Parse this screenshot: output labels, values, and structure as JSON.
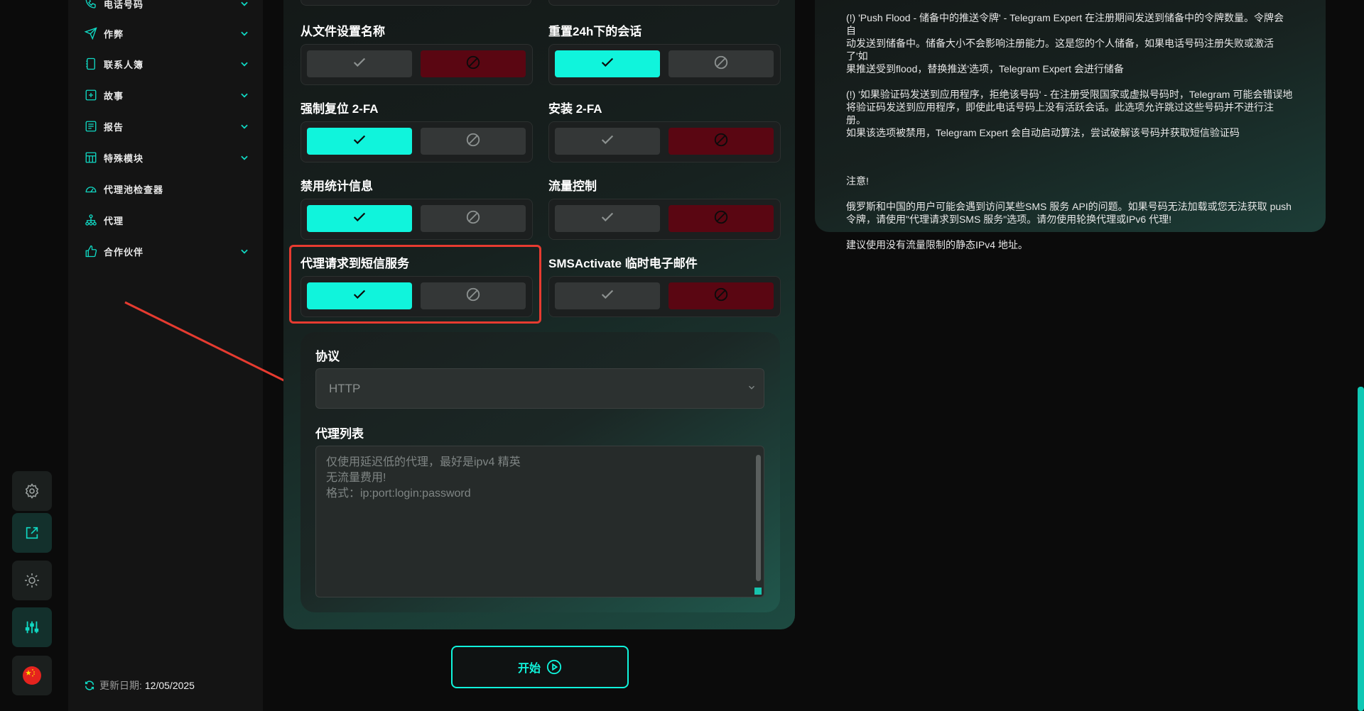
{
  "sidebar": {
    "items": [
      {
        "label": "电话号码",
        "icon": "phone-icon",
        "expandable": true
      },
      {
        "label": "作弊",
        "icon": "send-icon",
        "expandable": true
      },
      {
        "label": "联系人簿",
        "icon": "contacts-icon",
        "expandable": true
      },
      {
        "label": "故事",
        "icon": "plus-square-icon",
        "expandable": true
      },
      {
        "label": "报告",
        "icon": "report-icon",
        "expandable": true
      },
      {
        "label": "特殊模块",
        "icon": "modules-icon",
        "expandable": true
      },
      {
        "label": "代理池检查器",
        "icon": "gauge-icon",
        "expandable": false
      },
      {
        "label": "代理",
        "icon": "network-icon",
        "expandable": false
      },
      {
        "label": "合作伙伴",
        "icon": "thumbs-up-icon",
        "expandable": true
      }
    ],
    "update_label": "更新日期:",
    "update_date": "12/05/2025"
  },
  "rail": {
    "buttons": [
      "gear-icon",
      "external-link-icon",
      "sun-icon",
      "sliders-icon",
      "china-flag-icon"
    ],
    "active": "sliders-icon"
  },
  "settings": {
    "toggles": [
      {
        "title": "从文件设置名称",
        "state": "off"
      },
      {
        "title": "重置24h下的会话",
        "state": "on"
      },
      {
        "title": "强制复位 2-FA",
        "state": "on"
      },
      {
        "title": "安装 2-FA",
        "state": "off"
      },
      {
        "title": "禁用统计信息",
        "state": "on"
      },
      {
        "title": "流量控制",
        "state": "off"
      },
      {
        "title": "代理请求到短信服务",
        "state": "on",
        "highlighted": true
      },
      {
        "title": "SMSActivate 临时电子邮件",
        "state": "off"
      }
    ],
    "protocol_label": "协议",
    "protocol_value": "HTTP",
    "proxy_list_label": "代理列表",
    "proxy_placeholder": [
      "仅使用延迟低的代理，最好是ipv4 精英",
      "无流量费用!",
      "格式：ip:port:login:password"
    ],
    "start_label": "开始"
  },
  "info": {
    "paragraphs": [
      [
        "(!) 'Push Flood - 储备中的推送令牌' - Telegram Expert 在注册期间发送到储备中的令牌数量。令牌会自",
        "动发送到储备中。储备大小不会影响注册能力。这是您的个人储备，如果电话号码注册失败或激活了'如",
        "果推送受到flood，替换推送'选项，Telegram Expert 会进行储备"
      ],
      [
        "(!) '如果验证码发送到应用程序，拒绝该号码' - 在注册受限国家或虚拟号码时，Telegram 可能会错误地",
        "将验证码发送到应用程序，即使此电话号码上没有活跃会话。此选项允许跳过这些号码并不进行注册。",
        "如果该选项被禁用，Telegram Expert 会自动启动算法，尝试破解该号码并获取短信验证码"
      ],
      [
        "注意!"
      ],
      [
        "俄罗斯和中国的用户可能会遇到访问某些SMS 服务 API的问题。如果号码无法加载或您无法获取 push",
        "令牌，请使用\"代理请求到SMS 服务\"选项。请勿使用轮换代理或IPv6 代理!"
      ],
      [
        "建议使用没有流量限制的静态IPv4 地址。"
      ]
    ]
  },
  "colors": {
    "accent": "#10f4dc",
    "danger": "#5a0612",
    "highlight": "#e63b30"
  }
}
